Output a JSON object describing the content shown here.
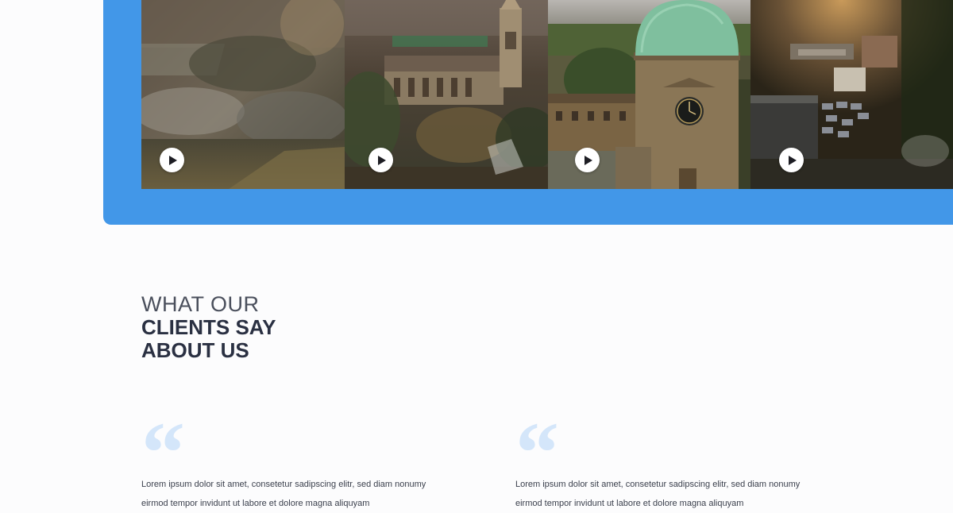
{
  "gallery": {
    "videos": [
      {
        "name": "village-aerial-video",
        "icon": "play-icon"
      },
      {
        "name": "church-aerial-video",
        "icon": "play-icon"
      },
      {
        "name": "clock-tower-video",
        "icon": "play-icon"
      },
      {
        "name": "sunset-yard-video",
        "icon": "play-icon"
      }
    ]
  },
  "testimonials": {
    "heading_light": "WHAT OUR",
    "heading_bold_line1": "CLIENTS SAY",
    "heading_bold_line2": "ABOUT US",
    "items": [
      {
        "quote_mark": "“",
        "text": "Lorem ipsum dolor sit amet, consetetur sadipscing elitr, sed diam nonumy eirmod tempor invidunt ut labore et dolore magna aliquyam"
      },
      {
        "quote_mark": "“",
        "text": "Lorem ipsum dolor sit amet, consetetur sadipscing elitr, sed diam nonumy eirmod tempor invidunt ut labore et dolore magna aliquyam"
      }
    ]
  },
  "colors": {
    "accent_blue": "#4297e8",
    "quote_mark": "#d4e6fa",
    "heading_dark": "#2a3042",
    "background": "#fcfcfd"
  }
}
